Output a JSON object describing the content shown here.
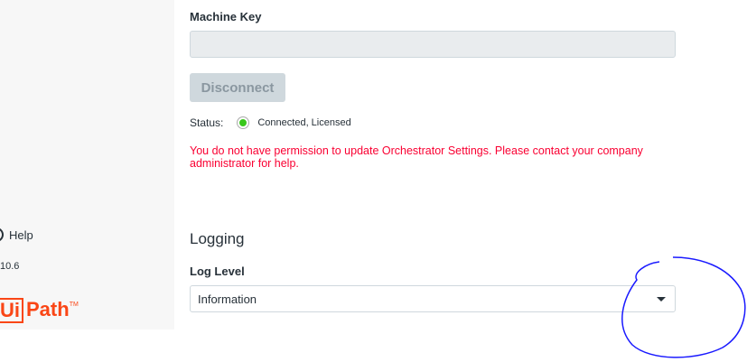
{
  "sidebar": {
    "help_label": "Help",
    "version": "10.6",
    "logo_text": "UiPath"
  },
  "machine_key": {
    "label": "Machine Key",
    "value": ""
  },
  "disconnect_label": "Disconnect",
  "status": {
    "label": "Status:",
    "value": "Connected, Licensed",
    "color": "#38c71a"
  },
  "error_message": "You do not have permission to update Orchestrator Settings. Please contact your company administrator for help.",
  "logging": {
    "title": "Logging",
    "log_level_label": "Log Level",
    "log_level_value": "Information"
  }
}
